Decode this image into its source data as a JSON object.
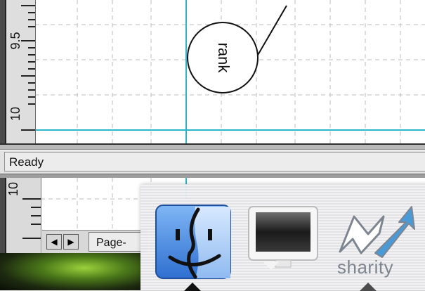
{
  "canvas": {
    "shape_label": "rank",
    "ruler_labels": [
      "9.5",
      "10"
    ]
  },
  "status": {
    "text": "Ready"
  },
  "lower_window": {
    "ruler_label": "10",
    "page_tab_label": "Page-",
    "nav_prev_icon": "triangle-left-icon",
    "nav_next_icon": "triangle-right-icon"
  },
  "dock": {
    "items": [
      {
        "name": "Finder",
        "icon": "finder-icon",
        "running": true
      },
      {
        "name": "Display",
        "icon": "display-icon",
        "running": false
      },
      {
        "name": "sharity",
        "icon": "sharity-icon",
        "running": true
      }
    ],
    "sharity_label": "sharity"
  },
  "colors": {
    "guide_line": "#2bb7c9",
    "grid": "#b8b8b8",
    "finder_blue": "#4b8fe0"
  }
}
